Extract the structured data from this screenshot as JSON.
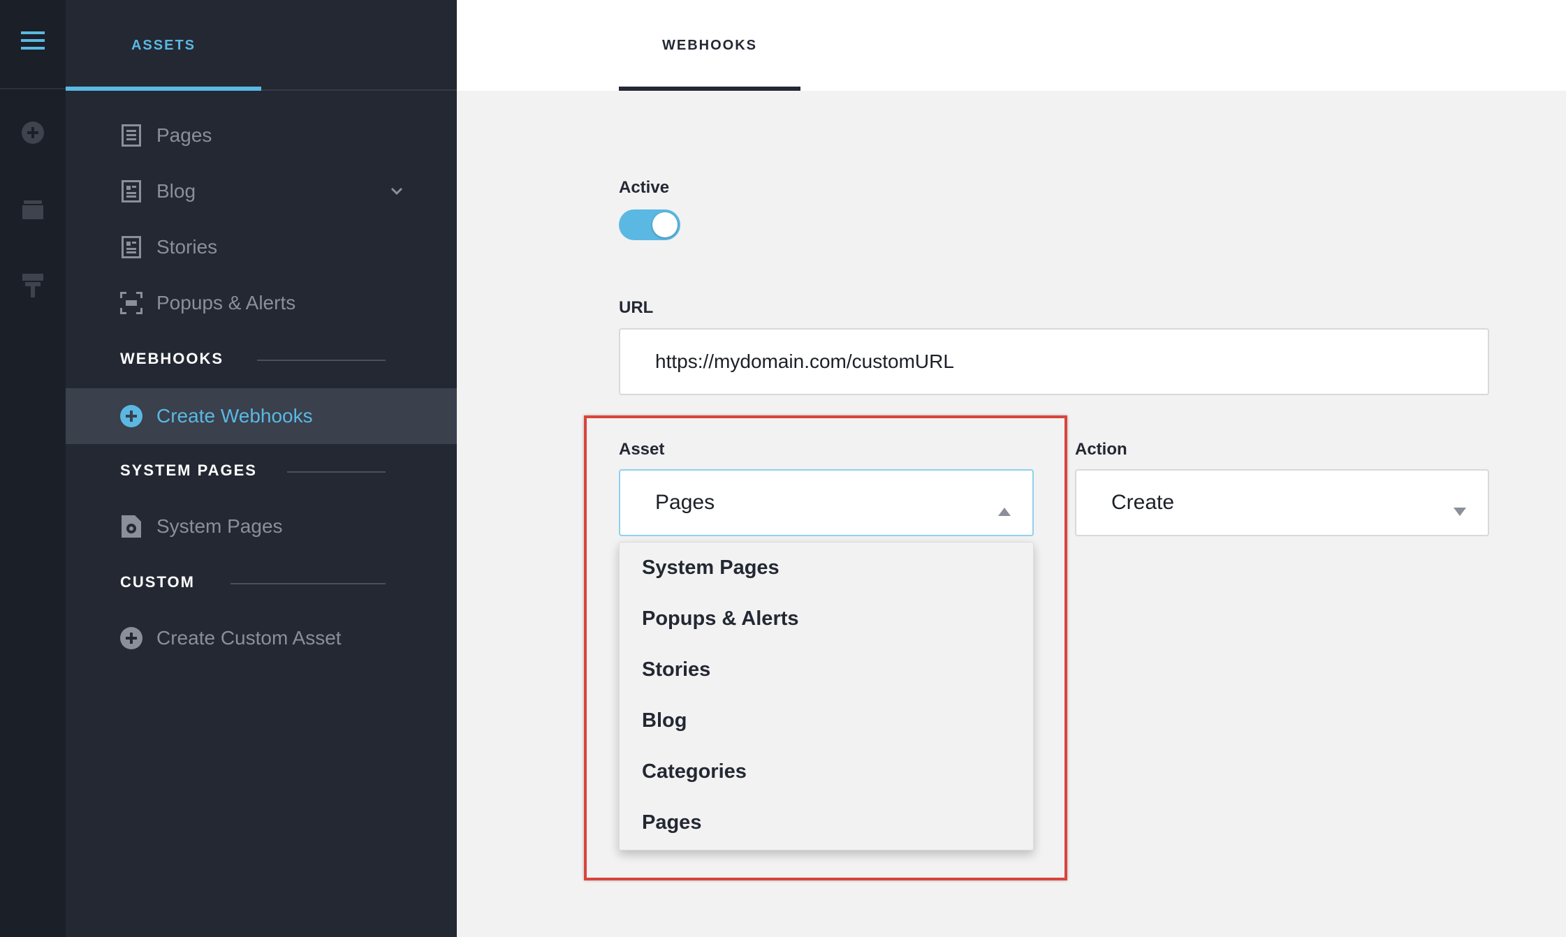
{
  "rail": {
    "icons": [
      "menu-icon",
      "add-circle-icon",
      "folder-icon",
      "paint-roller-icon"
    ]
  },
  "sidebar": {
    "tab_label": "ASSETS",
    "items": [
      {
        "label": "Pages",
        "icon": "page-icon"
      },
      {
        "label": "Blog",
        "icon": "page-icon",
        "expandable": true
      },
      {
        "label": "Stories",
        "icon": "page-icon"
      },
      {
        "label": "Popups & Alerts",
        "icon": "popup-icon"
      }
    ],
    "sections": {
      "webhooks": {
        "heading": "WEBHOOKS",
        "items": [
          {
            "label": "Create Webhooks",
            "icon": "add-circle-icon",
            "active": true
          }
        ]
      },
      "system_pages": {
        "heading": "SYSTEM PAGES",
        "items": [
          {
            "label": "System Pages",
            "icon": "settings-page-icon"
          }
        ]
      },
      "custom": {
        "heading": "CUSTOM",
        "items": [
          {
            "label": "Create Custom Asset",
            "icon": "add-circle-icon"
          }
        ]
      }
    }
  },
  "main": {
    "tab_label": "WEBHOOKS",
    "active": {
      "label": "Active",
      "value": true
    },
    "url": {
      "label": "URL",
      "value": "https://mydomain.com/customURL"
    },
    "asset": {
      "label": "Asset",
      "value": "Pages",
      "options": [
        "System Pages",
        "Popups & Alerts",
        "Stories",
        "Blog",
        "Categories",
        "Pages"
      ]
    },
    "action": {
      "label": "Action",
      "value": "Create"
    }
  },
  "colors": {
    "accent": "#5bb8e3",
    "rail_bg": "#1b1f27",
    "sidebar_bg": "#232833",
    "sidebar_active": "#3a404c",
    "highlight": "#d9443c"
  }
}
